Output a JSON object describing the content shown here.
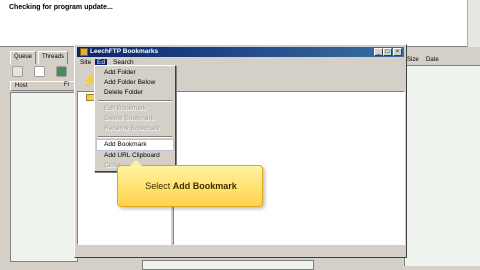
{
  "log": {
    "text": "Checking for program update..."
  },
  "left_panel": {
    "tabs": [
      "Queue",
      "Threads"
    ],
    "host_header": "Host",
    "fi_fragment": "Fi"
  },
  "right_panel": {
    "columns": [
      "Size",
      "Date"
    ]
  },
  "dialog": {
    "title": "LeechFTP Bookmarks",
    "menus": [
      "Site",
      "Ed",
      "Search"
    ],
    "title_buttons": [
      "_",
      "□",
      "×"
    ]
  },
  "dropdown": {
    "items": [
      {
        "label": "Add Folder",
        "enabled": true
      },
      {
        "label": "Add Folder Below",
        "enabled": true
      },
      {
        "label": "Delete Folder",
        "enabled": true
      },
      {
        "label": "Edit Bookmark",
        "enabled": false
      },
      {
        "label": "Delete Bookmark",
        "enabled": false
      },
      {
        "label": "Rename Bookmark",
        "enabled": false
      },
      {
        "label": "Add Bookmark",
        "enabled": true,
        "highlighted": true
      },
      {
        "label": "Add URL Clipboard",
        "enabled": true
      },
      {
        "label": "Close",
        "enabled": false
      }
    ]
  },
  "callout": {
    "prefix": "Select ",
    "emphasis": "Add Bookmark"
  }
}
